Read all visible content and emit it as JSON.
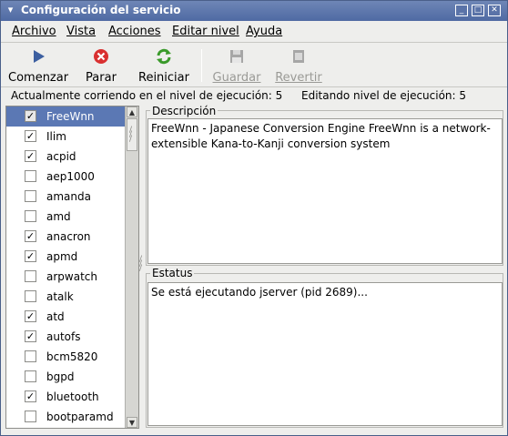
{
  "window": {
    "title": "Configuración del servicio"
  },
  "menubar": {
    "items": [
      {
        "label": "Archivo"
      },
      {
        "label": "Vista"
      },
      {
        "label": "Acciones"
      },
      {
        "label": "Editar nivel"
      },
      {
        "label": "Ayuda"
      }
    ]
  },
  "toolbar": {
    "buttons": [
      {
        "label": "Comenzar",
        "icon": "play-icon",
        "enabled": true
      },
      {
        "label": "Parar",
        "icon": "stop-icon",
        "enabled": true
      },
      {
        "label": "Reiniciar",
        "icon": "restart-icon",
        "enabled": true
      },
      {
        "label": "Guardar",
        "icon": "save-icon",
        "enabled": false
      },
      {
        "label": "Revertir",
        "icon": "revert-icon",
        "enabled": false
      }
    ]
  },
  "status": {
    "running_level": "Actualmente corriendo en el nivel de ejecución: 5",
    "editing_level": "Editando nivel de ejecución: 5"
  },
  "services": [
    {
      "name": "FreeWnn",
      "checked": true,
      "selected": true
    },
    {
      "name": "Ilim",
      "checked": true
    },
    {
      "name": "acpid",
      "checked": true
    },
    {
      "name": "aep1000",
      "checked": false
    },
    {
      "name": "amanda",
      "checked": false
    },
    {
      "name": "amd",
      "checked": false
    },
    {
      "name": "anacron",
      "checked": true
    },
    {
      "name": "apmd",
      "checked": true
    },
    {
      "name": "arpwatch",
      "checked": false
    },
    {
      "name": "atalk",
      "checked": false
    },
    {
      "name": "atd",
      "checked": true
    },
    {
      "name": "autofs",
      "checked": true
    },
    {
      "name": "bcm5820",
      "checked": false
    },
    {
      "name": "bgpd",
      "checked": false
    },
    {
      "name": "bluetooth",
      "checked": true
    },
    {
      "name": "bootparamd",
      "checked": false
    }
  ],
  "description": {
    "label": "Descripción",
    "text": "FreeWnn - Japanese Conversion Engine FreeWnn is a network-extensible Kana-to-Kanji conversion system"
  },
  "estatus": {
    "label": "Estatus",
    "text": "Se está ejecutando jserver (pid 2689)..."
  },
  "colors": {
    "titlebar": "#5a73a8",
    "selection": "#5b78b4",
    "restart_icon": "#3a9a2a",
    "stop_icon": "#d93030",
    "play_icon": "#3c5fa0"
  }
}
